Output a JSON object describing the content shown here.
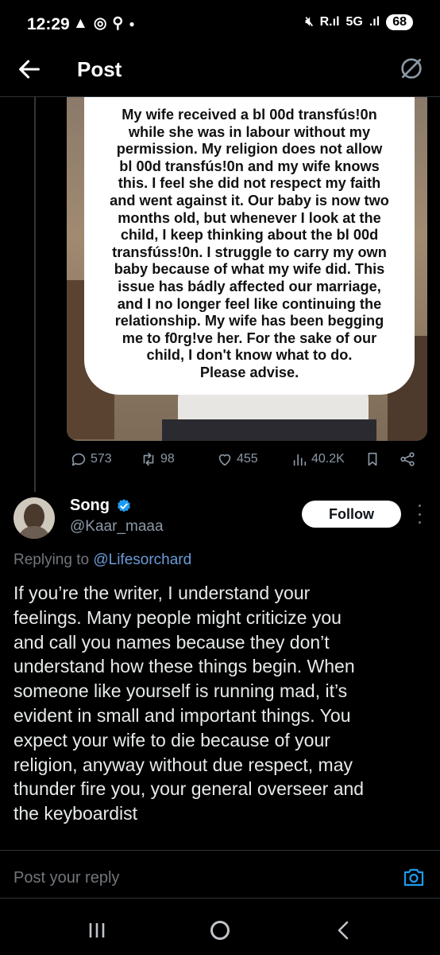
{
  "status_bar": {
    "time": "12:29",
    "left_icons": [
      "warning-icon",
      "whatsapp-icon",
      "person-add-icon",
      "dot-icon"
    ],
    "right_icons": [
      "mute-icon",
      "signal-r-icon",
      "5g-icon",
      "signal-icon"
    ],
    "network_label": "5G",
    "battery": "68"
  },
  "app_bar": {
    "title": "Post"
  },
  "post": {
    "image_text": "My wife received a bl 00d transfús!0n\nwhile she was in labour without my\npermission. My religion does not allow\nbl 00d transfús!0n and my wife knows\nthis. I feel she did not respect my faith\nand went against it. Our baby is now two\nmonths old, but whenever I look at the\nchild, I keep thinking about the bl 00d\ntransfúss!0n. I struggle to carry my own\nbaby because of what my wife did. This\nissue has bádly affected our marriage,\nand I no longer feel like continuing the\nrelationship. My wife has been begging\nme to f0rg!ve her. For the sake of our\nchild, I don't know what to do.\nPlease advise.",
    "metrics": {
      "replies": "573",
      "reposts": "98",
      "likes": "455",
      "views": "40.2K"
    }
  },
  "reply": {
    "display_name": "Song",
    "handle": "@Kaar_maaa",
    "follow_label": "Follow",
    "replying_prefix": "Replying to",
    "replying_to": "@Lifesorchard",
    "text": "If you’re the writer, I understand your\nfeelings. Many people might criticize you\nand call you names because they don’t\nunderstand how these things begin. When\nsomeone like yourself is running mad, it’s\nevident in small and important things. You\nexpect your wife to die because of your\nreligion,  anyway without due respect, may\nthunder fire you, your general overseer and\nthe keyboardist"
  },
  "composer": {
    "placeholder": "Post your reply"
  },
  "colors": {
    "background": "#000000",
    "text": "#e7e9ea",
    "muted": "#71767b",
    "mention": "#6b9bd8",
    "verified": "#1d9bf0"
  }
}
